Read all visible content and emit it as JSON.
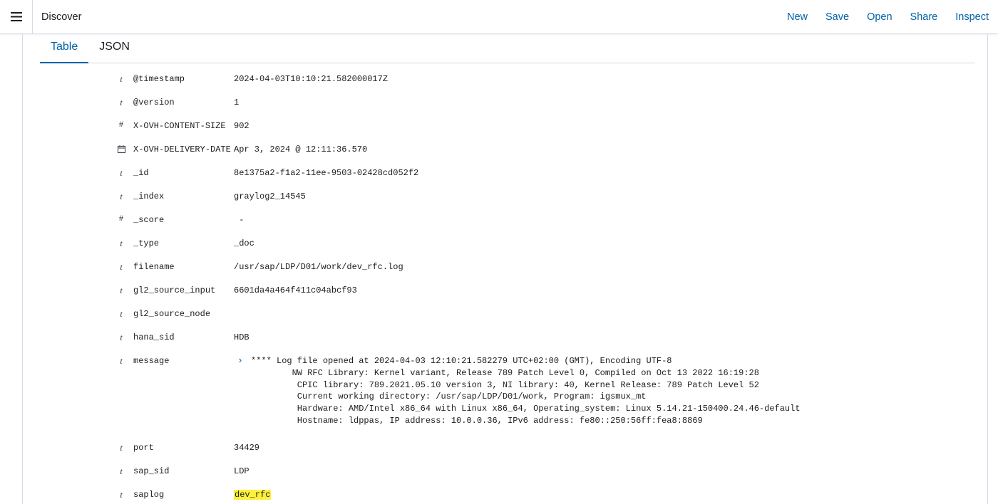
{
  "header": {
    "title": "Discover",
    "actions": [
      "New",
      "Save",
      "Open",
      "Share",
      "Inspect"
    ]
  },
  "tabs": [
    {
      "label": "Table",
      "active": true
    },
    {
      "label": "JSON",
      "active": false
    }
  ],
  "fields": [
    {
      "type": "string",
      "name": "@timestamp",
      "value": "2024-04-03T10:10:21.582000017Z"
    },
    {
      "type": "string",
      "name": "@version",
      "value": "1"
    },
    {
      "type": "number",
      "name": "X-OVH-CONTENT-SIZE",
      "value": "902"
    },
    {
      "type": "date",
      "name": "X-OVH-DELIVERY-DATE",
      "value": "Apr 3, 2024 @ 12:11:36.570"
    },
    {
      "type": "string",
      "name": "_id",
      "value": "8e1375a2-f1a2-11ee-9503-02428cd052f2"
    },
    {
      "type": "string",
      "name": "_index",
      "value": "graylog2_14545"
    },
    {
      "type": "number",
      "name": "_score",
      "value": " -"
    },
    {
      "type": "string",
      "name": "_type",
      "value": "_doc"
    },
    {
      "type": "string",
      "name": "filename",
      "value": "/usr/sap/LDP/D01/work/dev_rfc.log"
    },
    {
      "type": "string",
      "name": "gl2_source_input",
      "value": "6601da4a464f411c04abcf93"
    },
    {
      "type": "string",
      "name": "gl2_source_node",
      "value": ""
    },
    {
      "type": "string",
      "name": "hana_sid",
      "value": "HDB"
    },
    {
      "type": "string",
      "name": "message",
      "value": "",
      "expand_icon": "chevron-right-icon",
      "lines": [
        "**** Log file opened at 2024-04-03 12:10:21.582279 UTC+02:00 (GMT), Encoding UTF-8",
        "        NW RFC Library: Kernel variant, Release 789 Patch Level 0, Compiled on Oct 13 2022 16:19:28",
        "         CPIC library: 789.2021.05.10 version 3, NI library: 40, Kernel Release: 789 Patch Level 52",
        "         Current working directory: /usr/sap/LDP/D01/work, Program: igsmux_mt",
        "         Hardware: AMD/Intel x86_64 with Linux x86_64, Operating_system: Linux 5.14.21-150400.24.46-default",
        "         Hostname: ldppas, IP address: 10.0.0.36, IPv6 address: fe80::250:56ff:fea8:8869"
      ]
    },
    {
      "type": "string",
      "name": "port",
      "value": "34429"
    },
    {
      "type": "string",
      "name": "sap_sid",
      "value": "LDP"
    },
    {
      "type": "string",
      "name": "saplog",
      "value": "dev_rfc",
      "highlight": true
    }
  ],
  "type_glyphs": {
    "string": "t",
    "number": "#",
    "date": "calendar-icon"
  },
  "colors": {
    "link": "#0061a6",
    "border": "#d3dae6",
    "highlight": "#fff03c",
    "text": "#1a1c21"
  }
}
